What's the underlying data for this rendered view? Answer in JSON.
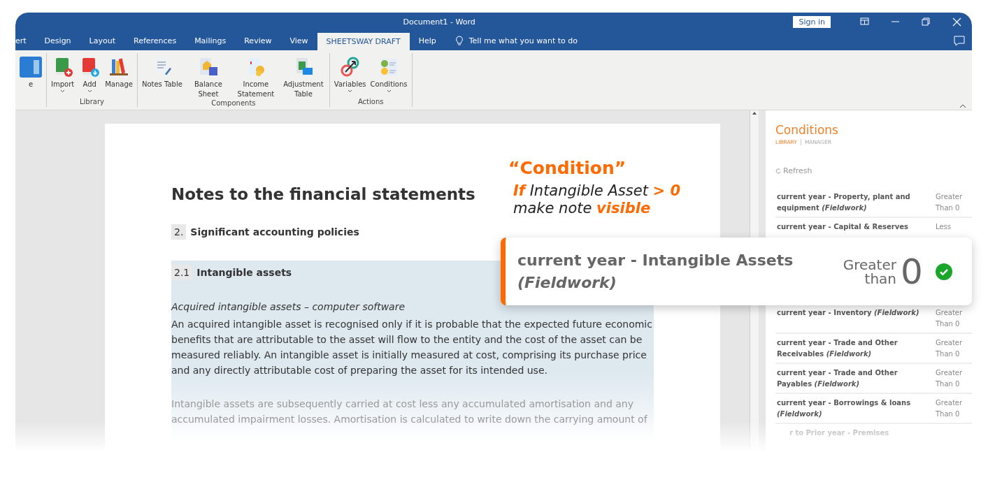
{
  "window": {
    "title": "Document1  -  Word",
    "sign_in": "Sign in"
  },
  "tabs": [
    {
      "label": "ert",
      "selected": false
    },
    {
      "label": "Design",
      "selected": false
    },
    {
      "label": "Layout",
      "selected": false
    },
    {
      "label": "References",
      "selected": false
    },
    {
      "label": "Mailings",
      "selected": false
    },
    {
      "label": "Review",
      "selected": false
    },
    {
      "label": "View",
      "selected": false
    },
    {
      "label": "SHEETSWAY DRAFT",
      "selected": true
    },
    {
      "label": "Help",
      "selected": false
    }
  ],
  "tell_me": "Tell me what you want to do",
  "ribbon": {
    "groups": [
      {
        "buttons": [
          {
            "label": "e",
            "dropdown": false
          }
        ]
      },
      {
        "label": "Library",
        "buttons": [
          {
            "label": "Import",
            "dropdown": true
          },
          {
            "label": "Add",
            "dropdown": true
          },
          {
            "label": "Manage",
            "dropdown": false
          }
        ]
      },
      {
        "label": "Components",
        "buttons": [
          {
            "label": "Notes Table",
            "dropdown": false
          },
          {
            "label": "Balance Sheet",
            "dropdown": false
          },
          {
            "label": "Income Statement",
            "dropdown": false
          },
          {
            "label": "Adjustment Table",
            "dropdown": false
          }
        ]
      },
      {
        "label": "Actions",
        "buttons": [
          {
            "label": "Variables",
            "dropdown": true
          },
          {
            "label": "Conditions",
            "dropdown": true
          }
        ]
      }
    ]
  },
  "document": {
    "heading": "Notes to the financial statements",
    "section": {
      "number": "2.",
      "title": "Significant accounting policies"
    },
    "subsection": {
      "number": "2.1",
      "title": "Intangible assets"
    },
    "subtitle": "Acquired intangible assets – computer software",
    "paragraphs": [
      "An acquired intangible asset is recognised only if it is probable that the expected future economic benefits that are attributable to the asset will flow to the entity and the cost of the asset can be measured reliably. An intangible asset is initially measured at cost, comprising its purchase price and any directly attributable cost of preparing the asset for its intended use.",
      "Intangible assets are subsequently carried at cost less any accumulated amortisation and any accumulated impairment losses. Amortisation is calculated to write down the carrying amount of"
    ]
  },
  "annotation": {
    "title": "“Condition”",
    "lines": [
      "**If** Intangible Asset **> 0**",
      "make note **visible**"
    ]
  },
  "pane": {
    "title": "Conditions",
    "tabs": [
      {
        "label": "LIBRARY",
        "selected": true
      },
      {
        "label": "MANAGER",
        "selected": false
      }
    ],
    "refresh": "Refresh",
    "items": [
      {
        "name": "current year - Property, plant and equipment *(Fieldwork)*",
        "condition": "Greater Than 0"
      },
      {
        "name": "current year - Capital & Reserves",
        "condition": "Less"
      }
    ],
    "items_below": [
      {
        "name": "current year - Inventory *(Fieldwork)*",
        "condition": "Greater Than 0"
      },
      {
        "name": "current year - Trade and Other Receivables *(Fieldwork)*",
        "condition": "Greater Than 0"
      },
      {
        "name": "current year - Trade and Other Payables *(Fieldwork)*",
        "condition": "Greater Than 0"
      },
      {
        "name": "current year - Borrowings & loans *(Fieldwork)*",
        "condition": "Greater Than 0"
      },
      {
        "name": "r to Prior year - Premises"
      }
    ]
  },
  "highlight": {
    "name": "current year - Intangible Assets *(Fieldwork)*",
    "condition": "Greater than",
    "value": "0",
    "met": true
  }
}
